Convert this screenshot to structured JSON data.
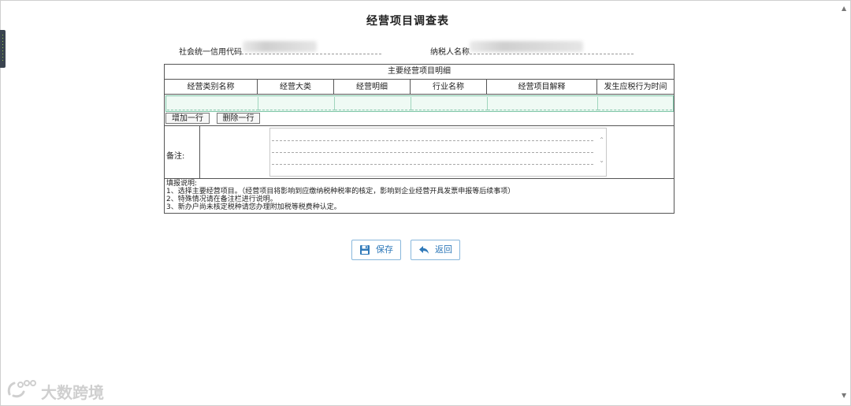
{
  "page": {
    "title": "经营项目调查表"
  },
  "taxpayer": {
    "credit_code_label": "社会统一信用代码",
    "name_label": "纳税人名称"
  },
  "main_section": {
    "title": "主要经营项目明细",
    "columns": [
      "经营类别名称",
      "经营大类",
      "经营明细",
      "行业名称",
      "经营项目解释",
      "发生应税行为时间"
    ],
    "add_row_label": "增加一行",
    "delete_row_label": "删除一行"
  },
  "remarks": {
    "label": "备注:"
  },
  "instructions": {
    "heading": "填报说明:",
    "lines": [
      "1、选择主要经营项目。（经营项目将影响到应缴纳税种税率的核定，影响到企业经营开具发票申报等后续事项）",
      "2、特殊情况请在备注栏进行说明。",
      "3、新办户尚未核定税种请您办理附加税等税费种认定。"
    ]
  },
  "actions": {
    "save_label": "保存",
    "back_label": "返回"
  },
  "watermark": {
    "text": "大数跨境"
  },
  "icons": {
    "save": "floppy-disk-icon",
    "back": "reply-arrow-icon",
    "scroll_up": "chevron-up-icon",
    "scroll_down": "chevron-down-icon"
  },
  "colors": {
    "accent": "#2f79b9",
    "input_row_bg": "#e8f6ef"
  }
}
